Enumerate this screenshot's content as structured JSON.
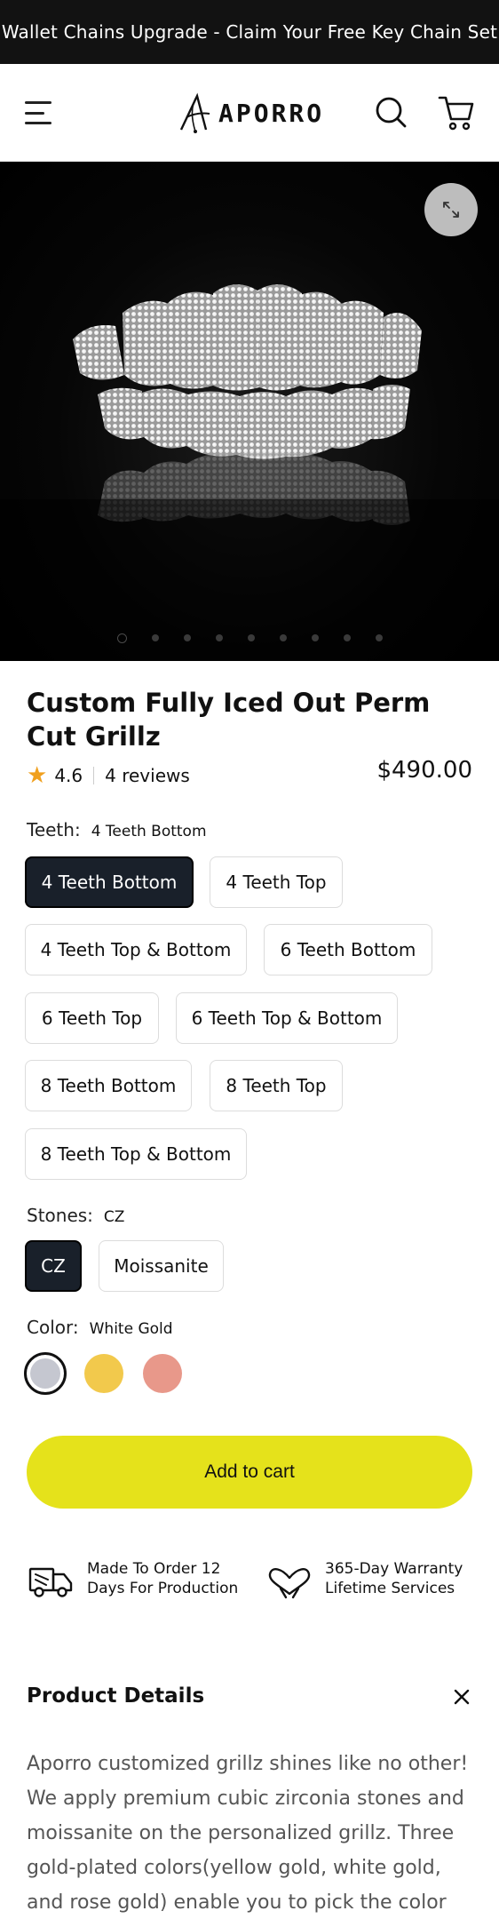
{
  "announcement": {
    "text": "Wallet Chains Upgrade - Claim Your Free Key Chain Set"
  },
  "header": {
    "logo_text": "APORRO",
    "icons": [
      "menu-icon",
      "search-icon",
      "cart-icon"
    ]
  },
  "gallery": {
    "image_subject": "iced out perm cut grillz",
    "slide_count": 9,
    "active_slide": 1,
    "icons": [
      "expand-icon"
    ]
  },
  "product": {
    "title": "Custom Fully Iced Out Perm Cut Grillz",
    "rating": "4.6",
    "reviews": "4 reviews",
    "price": "$490.00"
  },
  "teeth": {
    "label": "Teeth:",
    "selected": "4 Teeth Bottom",
    "options": [
      "4 Teeth Bottom",
      "4 Teeth Top",
      "4 Teeth Top & Bottom",
      "6 Teeth Bottom",
      "6 Teeth Top",
      "6 Teeth Top & Bottom",
      "8 Teeth Bottom",
      "8 Teeth Top",
      "8 Teeth Top & Bottom"
    ]
  },
  "stones": {
    "label": "Stones:",
    "selected": "CZ",
    "options": [
      "CZ",
      "Moissanite"
    ]
  },
  "color": {
    "label": "Color:",
    "selected": "White Gold",
    "swatches": [
      {
        "name": "White Gold",
        "hex": "#c5c7d0"
      },
      {
        "name": "Yellow Gold",
        "hex": "#f2c94c"
      },
      {
        "name": "Rose Gold",
        "hex": "#e8988a"
      }
    ]
  },
  "actions": {
    "add_to_cart": "Add to cart",
    "button_color": "#e5e21b"
  },
  "features": [
    {
      "icon": "truck-icon",
      "line1": "Made To Order 12",
      "line2": "Days For Production"
    },
    {
      "icon": "heart-hands-icon",
      "line1": "365-Day Warranty",
      "line2": "Lifetime Services"
    }
  ],
  "details": {
    "title": "Product Details",
    "body": "Aporro customized grillz shines like no other! We apply premium cubic zirconia stones and moissanite on the personalized grillz. Three gold-plated colors(yellow gold, white gold, and rose gold) enable you to pick the color"
  }
}
